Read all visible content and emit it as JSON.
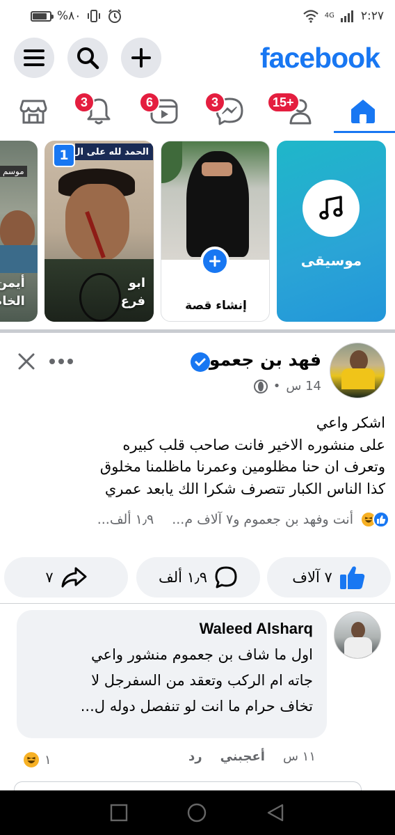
{
  "status_bar": {
    "left_text": "%٨٠",
    "time": "٢:٢٧",
    "network": "4G"
  },
  "header": {
    "logo": "facebook",
    "menu_icon": "menu-icon",
    "search_icon": "search-icon",
    "create_icon": "plus-icon"
  },
  "nav": {
    "tabs": [
      {
        "name": "marketplace",
        "icon": "store-icon",
        "badge": ""
      },
      {
        "name": "notifications",
        "icon": "bell-icon",
        "badge": "3"
      },
      {
        "name": "video",
        "icon": "video-icon",
        "badge": "6"
      },
      {
        "name": "messenger",
        "icon": "messenger-icon",
        "badge": "3"
      },
      {
        "name": "friends",
        "icon": "friends-icon",
        "badge": "15+"
      },
      {
        "name": "home",
        "icon": "home-icon",
        "badge": ""
      }
    ],
    "active_color": "#1877f2"
  },
  "stories": {
    "music_label": "موسيقى",
    "create_label": "إنشاء قصة",
    "story1_label_line1": "ابو",
    "story1_label_line2": "فرع",
    "story1_caption": "الحمد لله على ال",
    "story1_count": "1",
    "story2_label_line1": "أيمن",
    "story2_label_line2": "الخام",
    "story2_caption": "موسم"
  },
  "post": {
    "author": "فهد بن جعموم",
    "time": "14 س",
    "separator": "•",
    "text_lines": [
      "اشكر واعي",
      "على منشوره الاخير فانت صاحب قلب كبيره",
      "وتعرف ان حنا مظلومين وعمرنا ماظلمنا مخلوق",
      "كذا الناس الكبار تتصرف شكرا الك يابعد عمري"
    ],
    "reactions_text": "أنت وفهد بن جعموم و٧ آلاف م...",
    "comments_count_text": "١٫٩ ألف...",
    "like_count": "٧ آلاف",
    "comment_count": "١٫٩ ألف",
    "share_count": "٧"
  },
  "comment": {
    "author": "Waleed Alsharq",
    "text_lines": [
      "اول ما شاف بن جعموم منشور واعي",
      "جاته ام الركب وتعقد من السفرجل لا",
      "تخاف حرام ما انت لو تنفصل دوله ل..."
    ],
    "time": "١١ س",
    "like_label": "أعجبني",
    "reply_label": "رد",
    "reaction_count": "١"
  }
}
